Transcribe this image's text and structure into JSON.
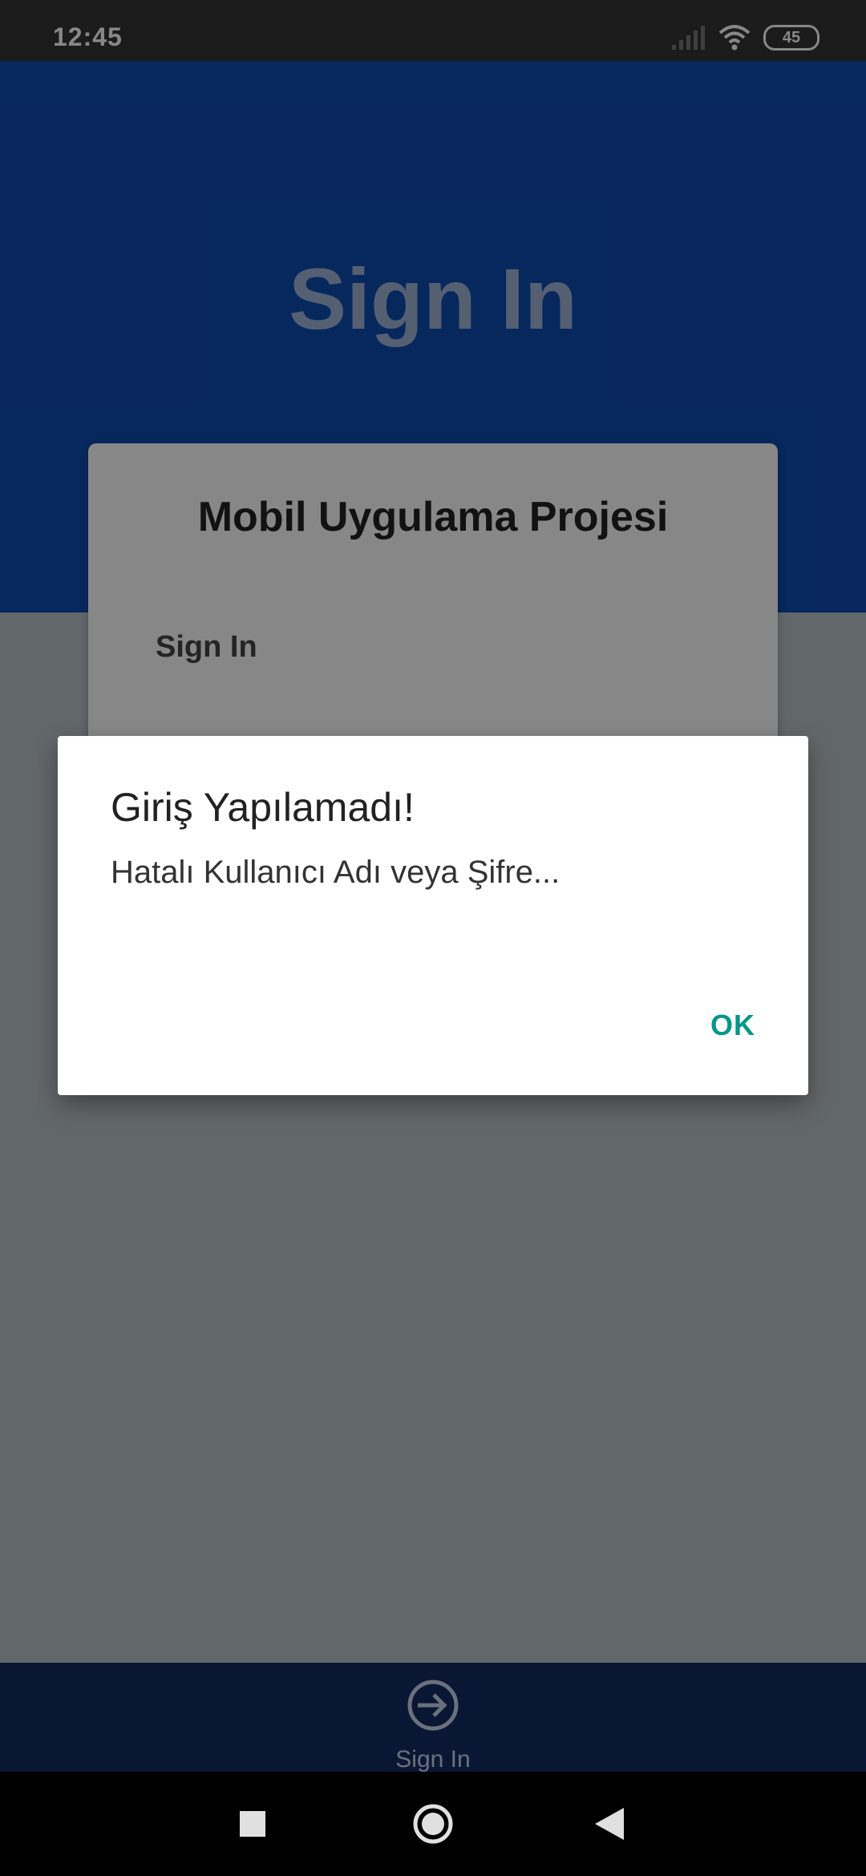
{
  "status_bar": {
    "time": "12:45",
    "battery": "45"
  },
  "header": {
    "title": "Sign In"
  },
  "card": {
    "title": "Mobil Uygulama Projesi",
    "subtitle": "Sign In"
  },
  "dialog": {
    "title": "Giriş Yapılamadı!",
    "message": "Hatalı Kullanıcı Adı veya Şifre...",
    "ok_label": "OK"
  },
  "bottom_nav": {
    "items": [
      {
        "label": "Sign In",
        "icon": "sign-in-icon"
      }
    ]
  },
  "system_nav": {
    "buttons": [
      "recents-icon",
      "home-icon",
      "back-icon"
    ]
  },
  "colors": {
    "primary": "#0f4cb0",
    "status_bar": "#333333",
    "accent": "#009688",
    "bottom_nav": "#122a63"
  }
}
